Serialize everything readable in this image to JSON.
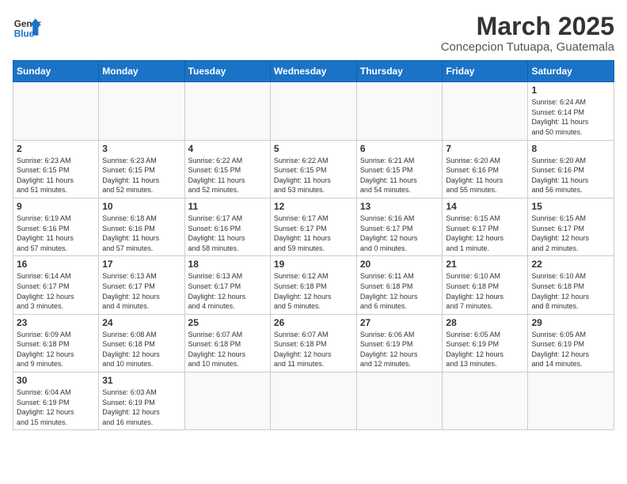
{
  "header": {
    "logo_general": "General",
    "logo_blue": "Blue",
    "month_title": "March 2025",
    "location": "Concepcion Tutuapa, Guatemala"
  },
  "days_of_week": [
    "Sunday",
    "Monday",
    "Tuesday",
    "Wednesday",
    "Thursday",
    "Friday",
    "Saturday"
  ],
  "weeks": [
    [
      {
        "day": "",
        "info": ""
      },
      {
        "day": "",
        "info": ""
      },
      {
        "day": "",
        "info": ""
      },
      {
        "day": "",
        "info": ""
      },
      {
        "day": "",
        "info": ""
      },
      {
        "day": "",
        "info": ""
      },
      {
        "day": "1",
        "info": "Sunrise: 6:24 AM\nSunset: 6:14 PM\nDaylight: 11 hours\nand 50 minutes."
      }
    ],
    [
      {
        "day": "2",
        "info": "Sunrise: 6:23 AM\nSunset: 6:15 PM\nDaylight: 11 hours\nand 51 minutes."
      },
      {
        "day": "3",
        "info": "Sunrise: 6:23 AM\nSunset: 6:15 PM\nDaylight: 11 hours\nand 52 minutes."
      },
      {
        "day": "4",
        "info": "Sunrise: 6:22 AM\nSunset: 6:15 PM\nDaylight: 11 hours\nand 52 minutes."
      },
      {
        "day": "5",
        "info": "Sunrise: 6:22 AM\nSunset: 6:15 PM\nDaylight: 11 hours\nand 53 minutes."
      },
      {
        "day": "6",
        "info": "Sunrise: 6:21 AM\nSunset: 6:15 PM\nDaylight: 11 hours\nand 54 minutes."
      },
      {
        "day": "7",
        "info": "Sunrise: 6:20 AM\nSunset: 6:16 PM\nDaylight: 11 hours\nand 55 minutes."
      },
      {
        "day": "8",
        "info": "Sunrise: 6:20 AM\nSunset: 6:16 PM\nDaylight: 11 hours\nand 56 minutes."
      }
    ],
    [
      {
        "day": "9",
        "info": "Sunrise: 6:19 AM\nSunset: 6:16 PM\nDaylight: 11 hours\nand 57 minutes."
      },
      {
        "day": "10",
        "info": "Sunrise: 6:18 AM\nSunset: 6:16 PM\nDaylight: 11 hours\nand 57 minutes."
      },
      {
        "day": "11",
        "info": "Sunrise: 6:17 AM\nSunset: 6:16 PM\nDaylight: 11 hours\nand 58 minutes."
      },
      {
        "day": "12",
        "info": "Sunrise: 6:17 AM\nSunset: 6:17 PM\nDaylight: 11 hours\nand 59 minutes."
      },
      {
        "day": "13",
        "info": "Sunrise: 6:16 AM\nSunset: 6:17 PM\nDaylight: 12 hours\nand 0 minutes."
      },
      {
        "day": "14",
        "info": "Sunrise: 6:15 AM\nSunset: 6:17 PM\nDaylight: 12 hours\nand 1 minute."
      },
      {
        "day": "15",
        "info": "Sunrise: 6:15 AM\nSunset: 6:17 PM\nDaylight: 12 hours\nand 2 minutes."
      }
    ],
    [
      {
        "day": "16",
        "info": "Sunrise: 6:14 AM\nSunset: 6:17 PM\nDaylight: 12 hours\nand 3 minutes."
      },
      {
        "day": "17",
        "info": "Sunrise: 6:13 AM\nSunset: 6:17 PM\nDaylight: 12 hours\nand 4 minutes."
      },
      {
        "day": "18",
        "info": "Sunrise: 6:13 AM\nSunset: 6:17 PM\nDaylight: 12 hours\nand 4 minutes."
      },
      {
        "day": "19",
        "info": "Sunrise: 6:12 AM\nSunset: 6:18 PM\nDaylight: 12 hours\nand 5 minutes."
      },
      {
        "day": "20",
        "info": "Sunrise: 6:11 AM\nSunset: 6:18 PM\nDaylight: 12 hours\nand 6 minutes."
      },
      {
        "day": "21",
        "info": "Sunrise: 6:10 AM\nSunset: 6:18 PM\nDaylight: 12 hours\nand 7 minutes."
      },
      {
        "day": "22",
        "info": "Sunrise: 6:10 AM\nSunset: 6:18 PM\nDaylight: 12 hours\nand 8 minutes."
      }
    ],
    [
      {
        "day": "23",
        "info": "Sunrise: 6:09 AM\nSunset: 6:18 PM\nDaylight: 12 hours\nand 9 minutes."
      },
      {
        "day": "24",
        "info": "Sunrise: 6:08 AM\nSunset: 6:18 PM\nDaylight: 12 hours\nand 10 minutes."
      },
      {
        "day": "25",
        "info": "Sunrise: 6:07 AM\nSunset: 6:18 PM\nDaylight: 12 hours\nand 10 minutes."
      },
      {
        "day": "26",
        "info": "Sunrise: 6:07 AM\nSunset: 6:18 PM\nDaylight: 12 hours\nand 11 minutes."
      },
      {
        "day": "27",
        "info": "Sunrise: 6:06 AM\nSunset: 6:19 PM\nDaylight: 12 hours\nand 12 minutes."
      },
      {
        "day": "28",
        "info": "Sunrise: 6:05 AM\nSunset: 6:19 PM\nDaylight: 12 hours\nand 13 minutes."
      },
      {
        "day": "29",
        "info": "Sunrise: 6:05 AM\nSunset: 6:19 PM\nDaylight: 12 hours\nand 14 minutes."
      }
    ],
    [
      {
        "day": "30",
        "info": "Sunrise: 6:04 AM\nSunset: 6:19 PM\nDaylight: 12 hours\nand 15 minutes."
      },
      {
        "day": "31",
        "info": "Sunrise: 6:03 AM\nSunset: 6:19 PM\nDaylight: 12 hours\nand 16 minutes."
      },
      {
        "day": "",
        "info": ""
      },
      {
        "day": "",
        "info": ""
      },
      {
        "day": "",
        "info": ""
      },
      {
        "day": "",
        "info": ""
      },
      {
        "day": "",
        "info": ""
      }
    ]
  ]
}
